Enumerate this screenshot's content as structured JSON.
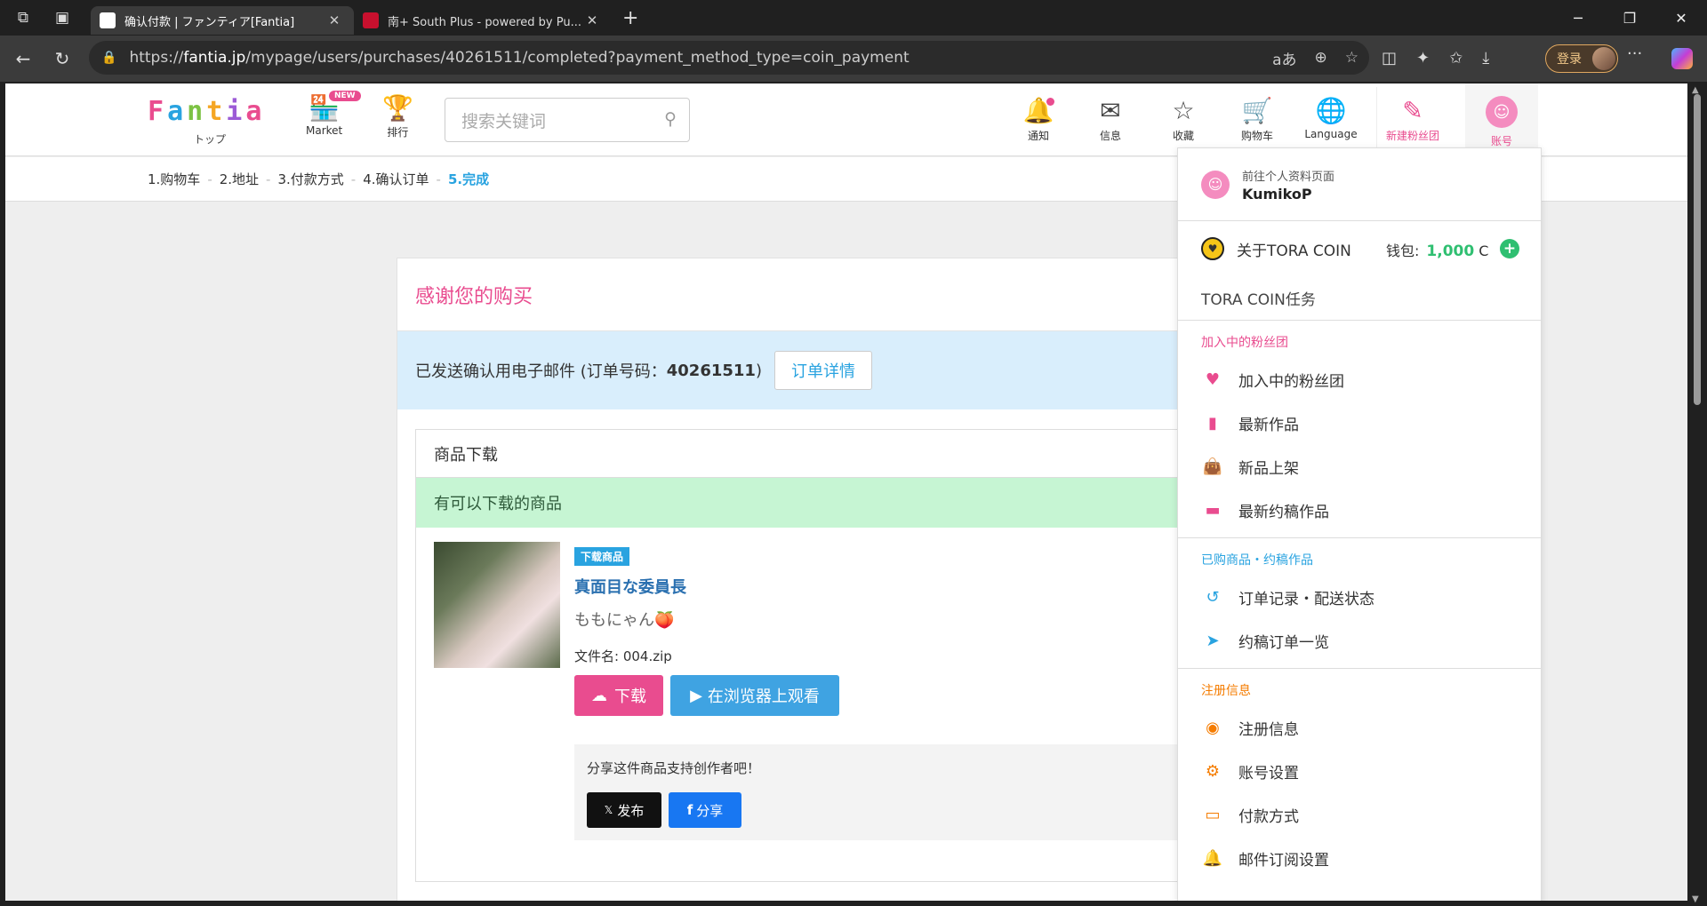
{
  "browser": {
    "tabs": [
      {
        "title": "确认付款 | ファンティア[Fantia]",
        "active": true,
        "favicon_color": "#ffffff"
      },
      {
        "title": "南+ South Plus - powered by Pu...",
        "active": false,
        "favicon_color": "#c8102e"
      }
    ],
    "url_prefix": "https://",
    "url_host": "fantia.jp",
    "url_path": "/mypage/users/purchases/40261511/completed?payment_method_type=coin_payment",
    "login_label": "登录",
    "icons": [
      "workspaces-icon",
      "tab-actions-icon",
      "back-icon",
      "refresh-icon",
      "lock-icon",
      "read-aloud-icon",
      "zoom-icon",
      "favorite-star-icon",
      "extension-icon",
      "favorites-icon",
      "downloads-icon",
      "more-icon",
      "copilot-icon",
      "new-tab-icon",
      "minimize-icon",
      "maximize-icon",
      "close-icon"
    ]
  },
  "header": {
    "logo_text": "Fantia",
    "logo_sub": "トップ",
    "nav": [
      {
        "label": "Market",
        "badge": "NEW"
      },
      {
        "label": "排行"
      }
    ],
    "search_placeholder": "搜索关键词",
    "icons": [
      {
        "label": "通知",
        "icon": "bell-icon"
      },
      {
        "label": "信息",
        "icon": "envelope-icon"
      },
      {
        "label": "收藏",
        "icon": "star-icon"
      },
      {
        "label": "购物车",
        "icon": "cart-icon"
      },
      {
        "label": "Language",
        "icon": "globe-icon"
      },
      {
        "label": "新建粉丝团",
        "icon": "pencil-icon"
      },
      {
        "label": "账号",
        "icon": "face-icon"
      }
    ],
    "accent": "#e94c8f"
  },
  "steps": {
    "items": [
      "1.购物车",
      "2.地址",
      "3.付款方式",
      "4.确认订单",
      "5.完成"
    ],
    "separator": "-",
    "current_index": 4
  },
  "main": {
    "title": "感谢您的购买",
    "confirm_text": "已发送确认用电子邮件 (订单号码：",
    "order_number": "40261511",
    "confirm_close": ")",
    "detail_button": "订单详情",
    "download_box": {
      "heading": "商品下载",
      "available": "有可以下载的商品",
      "product": {
        "tag": "下载商品",
        "title": "真面目な委員長",
        "creator": "ももにゃん🍑",
        "filename_label": "文件名: 004.zip",
        "download_button": "下载",
        "view_button": "在浏览器上观看"
      },
      "share": {
        "text": "分享这件商品支持创作者吧！",
        "x_button": "发布",
        "fb_button": "分享"
      }
    }
  },
  "dropdown": {
    "profile_link": "前往个人资料页面",
    "username": "KumikoP",
    "coin_label": "关于TORA COIN",
    "wallet_label": "钱包:",
    "wallet_amount": "1,000",
    "wallet_unit": "C",
    "mission": "TORA COIN任务",
    "sections": [
      {
        "title": "加入中的粉丝团",
        "color": "#e94c8f",
        "items": [
          {
            "label": "加入中的粉丝团",
            "icon": "heart-icon",
            "color": "#e94c8f"
          },
          {
            "label": "最新作品",
            "icon": "file-icon",
            "color": "#e94c8f"
          },
          {
            "label": "新品上架",
            "icon": "shopping-bag-icon",
            "color": "#e94c8f"
          },
          {
            "label": "最新约稿作品",
            "icon": "inbox-icon",
            "color": "#e94c8f"
          }
        ]
      },
      {
        "title": "已购商品・约稿作品",
        "color": "#29a3e0",
        "items": [
          {
            "label": "订单记录・配送状态",
            "icon": "history-icon",
            "color": "#29a3e0"
          },
          {
            "label": "约稿订单一览",
            "icon": "paper-plane-icon",
            "color": "#29a3e0"
          }
        ]
      },
      {
        "title": "注册信息",
        "color": "#f57c00",
        "items": [
          {
            "label": "注册信息",
            "icon": "user-circle-icon",
            "color": "#f57c00"
          },
          {
            "label": "账号设置",
            "icon": "gear-icon",
            "color": "#f57c00"
          },
          {
            "label": "付款方式",
            "icon": "credit-card-icon",
            "color": "#f57c00"
          },
          {
            "label": "邮件订阅设置",
            "icon": "bell-icon",
            "color": "#f57c00"
          }
        ]
      }
    ]
  }
}
